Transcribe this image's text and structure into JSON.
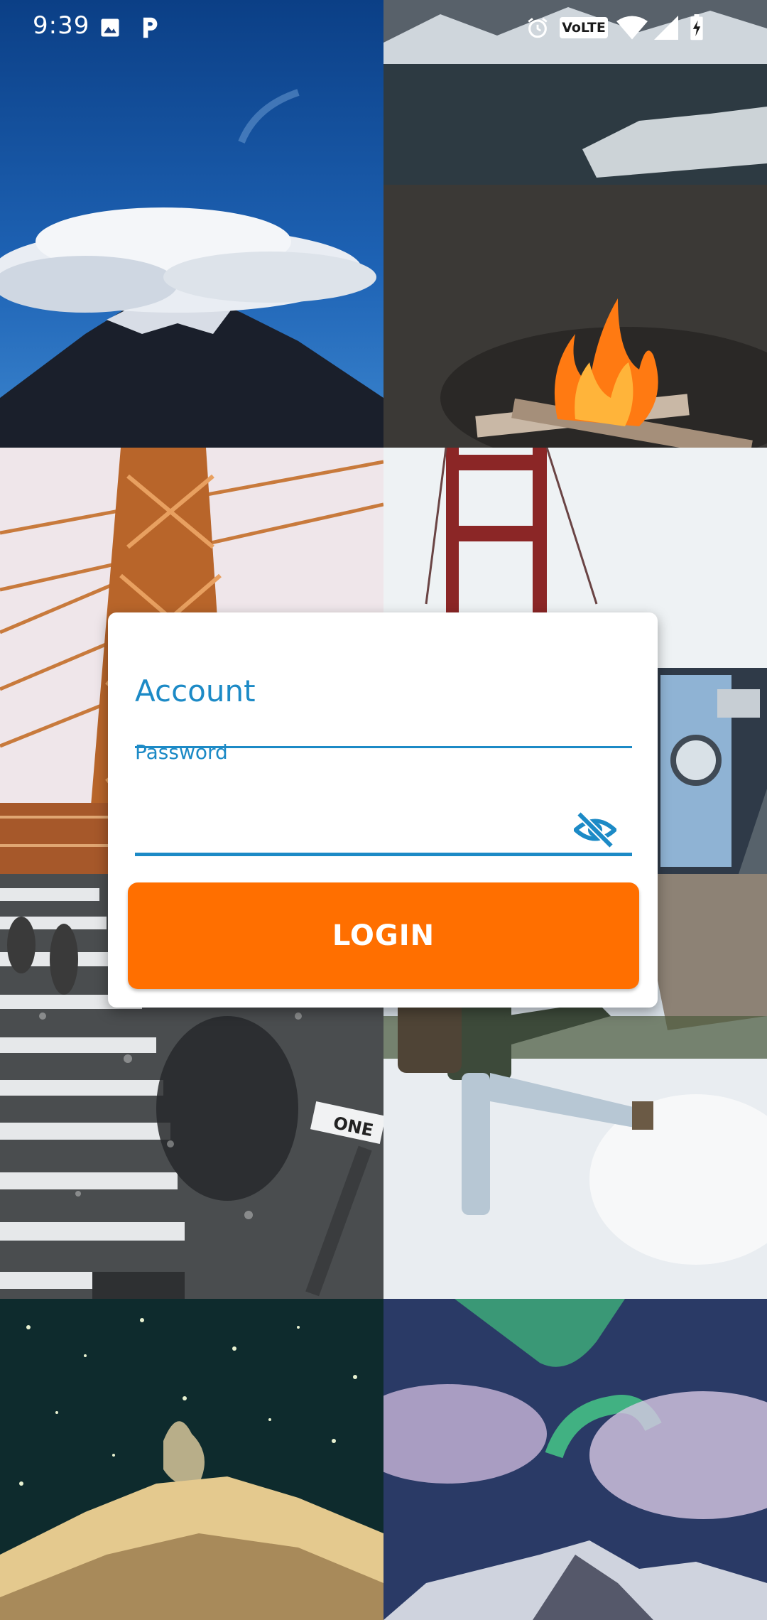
{
  "status_bar": {
    "time": "9:39",
    "left_icons": [
      "image-icon",
      "parking-icon"
    ],
    "right_icons": [
      "alarm-icon",
      "volte-icon",
      "wifi-icon",
      "signal-icon",
      "battery-charging-icon"
    ],
    "volte_label": "VoLTE"
  },
  "background": {
    "photos": [
      "volcano-cloud-photo",
      "campfire-lake-photo",
      "bridge-tower-photo",
      "golden-gate-bridge-photo",
      "crosswalk-rain-photo",
      "hiker-snow-photo",
      "starry-mountain-photo",
      "aurora-mountain-photo"
    ],
    "street_sign_text": "ONE"
  },
  "login": {
    "account_placeholder": "Account",
    "password_label": "Password",
    "password_value": "",
    "button_label": "LOGIN"
  },
  "colors": {
    "accent": "#1c8ac6",
    "button": "#ff6f00",
    "card": "#ffffff"
  }
}
